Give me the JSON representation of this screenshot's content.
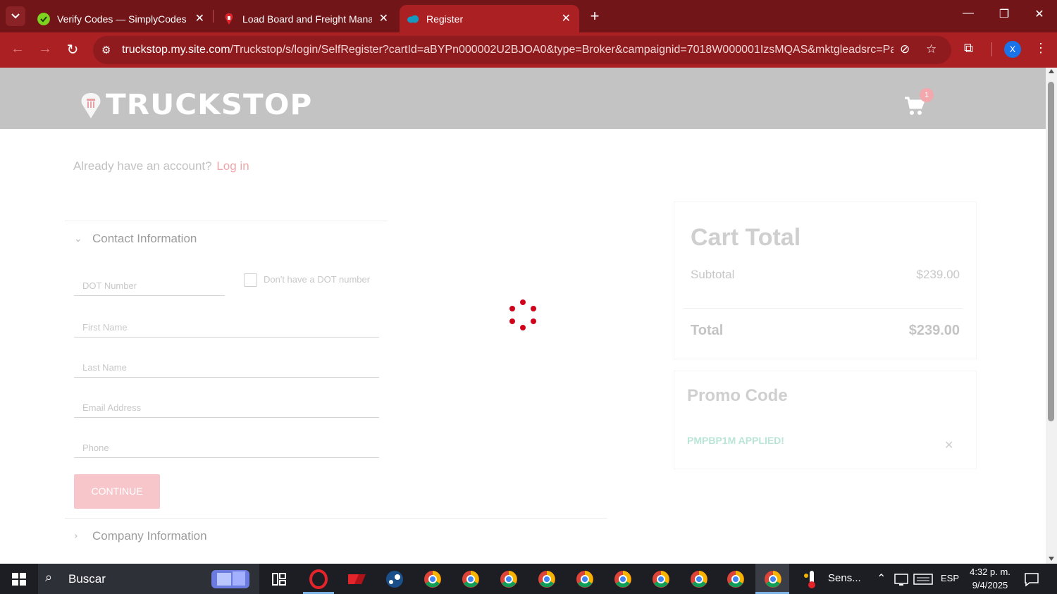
{
  "browser": {
    "tabs": [
      {
        "title": "Verify Codes — SimplyCodes",
        "favicon": "simplycodes-icon",
        "favicon_color": "#7ed321"
      },
      {
        "title": "Load Board and Freight Manag",
        "favicon": "truckstop-icon",
        "favicon_color": "#e3242b"
      },
      {
        "title": "Register",
        "favicon": "salesforce-cloud-icon",
        "favicon_color": "#1798c1",
        "active": true
      }
    ],
    "url_host": "truckstop.my.site.com",
    "url_rest": "/Truckstop/s/login/SelfRegister?cartId=aBYPn000002U2BJOA0&type=Broker&campaignid=7018W000001IzsMQAS&mktgleadsrc=Partner...",
    "profile_initial": "X",
    "accent": "#ab2023"
  },
  "site": {
    "logo_text": "TRUCKSTOP",
    "cart_count": "1"
  },
  "account": {
    "prompt": "Already have an account?",
    "login_link": "Log in"
  },
  "contact": {
    "section_title": "Contact Information",
    "dot_placeholder": "DOT Number",
    "no_dot_label": "Don't have a DOT number",
    "first_name_placeholder": "First Name",
    "last_name_placeholder": "Last Name",
    "email_placeholder": "Email Address",
    "phone_placeholder": "Phone",
    "continue_label": "CONTINUE"
  },
  "company": {
    "section_title": "Company Information"
  },
  "cart": {
    "title": "Cart Total",
    "subtotal_label": "Subtotal",
    "subtotal_value": "$239.00",
    "total_label": "Total",
    "total_value": "$239.00"
  },
  "promo": {
    "title": "Promo Code",
    "applied_text": "PMPBP1M APPLIED!",
    "applied_color": "#b9e6d6"
  },
  "taskbar": {
    "search_placeholder": "Buscar",
    "weather_label": "Sens...",
    "language": "ESP",
    "time": "4:32 p. m.",
    "date": "9/4/2025"
  }
}
